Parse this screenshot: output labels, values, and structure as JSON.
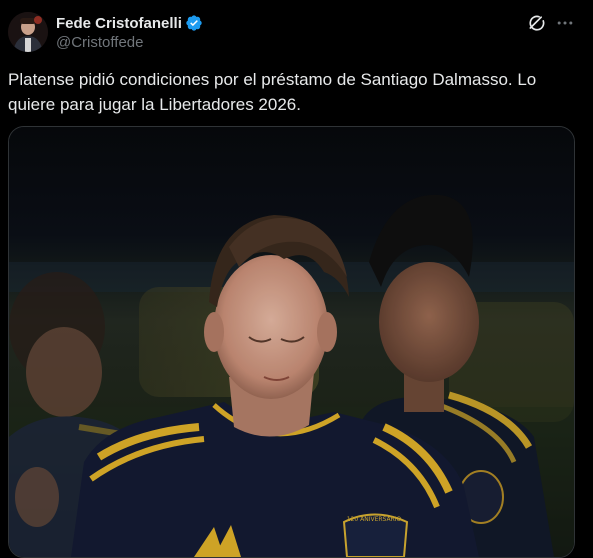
{
  "tweet": {
    "author": {
      "display_name": "Fede Cristofanelli",
      "handle": "@Cristoffede",
      "verified": true
    },
    "text": "Platense pidió condiciones por el préstamo de Santiago Dalmasso. Lo quiere para jugar la Libertadores 2026.",
    "media": {
      "kind": "photo"
    }
  },
  "icons": {
    "verified": "verified-badge-icon",
    "grok": "grok-icon",
    "more": "more-options-icon"
  },
  "colors": {
    "background": "#000000",
    "text_primary": "#e7e9ea",
    "text_secondary": "#71767b",
    "verified_blue": "#1d9bf0",
    "jersey_navy": "#141b33",
    "jersey_gold": "#e0b12a"
  }
}
